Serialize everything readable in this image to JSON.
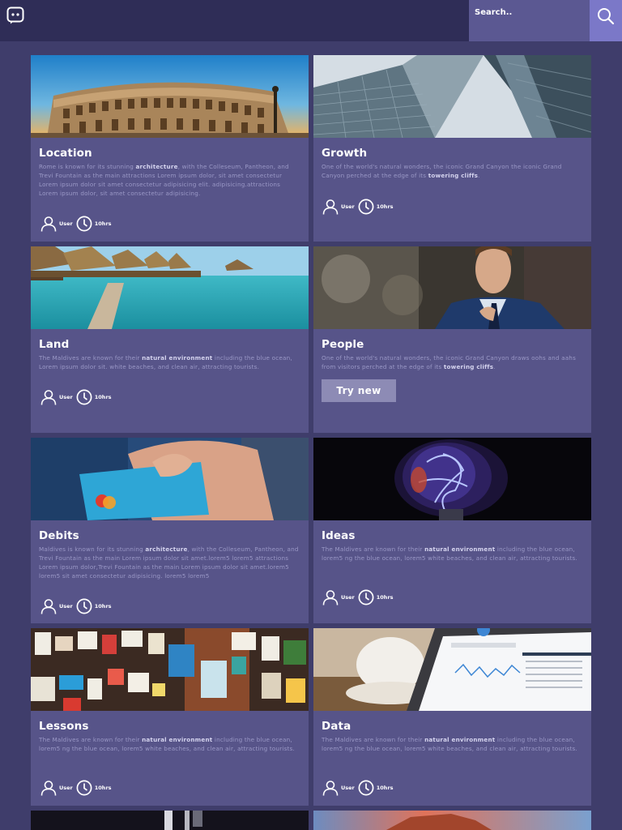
{
  "header": {
    "search_placeholder": "Search.."
  },
  "cards": [
    {
      "title": "Location",
      "desc_parts": [
        "Rome is known for its stunning ",
        "architecture",
        ", with the Colleseum, Pantheon, and Trevi Fountain as the main attractions Lorem ipsum dolor, sit amet consectetur Lorem ipsum dolor sit amet consectetur adipisicing elit. adipisicing.attractions Lorem ipsum dolor, sit amet consectetur adipisicing."
      ],
      "user_label": "User",
      "time_label": "10hrs"
    },
    {
      "title": "Growth",
      "desc_parts": [
        "One of the world's natural wonders, the iconic Grand Canyon the iconic Grand Canyon perched at the edge of its ",
        "towering cliffs",
        "."
      ],
      "user_label": "User",
      "time_label": "10hrs"
    },
    {
      "title": "Land",
      "desc_parts": [
        "The Maldives are known for their ",
        "natural environment",
        " including the blue ocean, Lorem ipsum dolor sit. white beaches, and clean air, attracting tourists."
      ],
      "user_label": "User",
      "time_label": "10hrs"
    },
    {
      "title": "People",
      "desc_parts": [
        "One of the world's natural wonders, the iconic Grand Canyon draws oohs and aahs from visitors perched at the edge of its ",
        "towering cliffs",
        "."
      ],
      "button_label": "Try new"
    },
    {
      "title": "Debits",
      "desc_parts": [
        "Maldives is known for its stunning ",
        "architecture",
        ", with the Colleseum, Pantheon, and Trevi Fountain as the main Lorem ipsum dolor sit amet.lorem5 lorem5 attractions Lorem ipsum dolor,Trevi Fountain as the main Lorem ipsum dolor sit amet.lorem5 lorem5 sit amet consectetur adipisicing. lorem5 lorem5"
      ],
      "user_label": "User",
      "time_label": "10hrs"
    },
    {
      "title": "Ideas",
      "desc_parts": [
        "The Maldives are known for their ",
        "natural environment",
        " including the blue ocean, lorem5 ng the blue ocean, lorem5 white beaches, and clean air, attracting tourists."
      ],
      "user_label": "User",
      "time_label": "10hrs"
    },
    {
      "title": "Lessons",
      "desc_parts": [
        "The Maldives are known for their ",
        "natural environment",
        " including the blue ocean, lorem5 ng the blue ocean, lorem5 white beaches, and clean air, attracting tourists."
      ],
      "user_label": "User",
      "time_label": "10hrs"
    },
    {
      "title": "Data",
      "desc_parts": [
        "The Maldives are known for their ",
        "natural environment",
        " including the blue ocean, lorem5 ng the blue ocean, lorem5 white beaches, and clean air, attracting tourists."
      ],
      "user_label": "User",
      "time_label": "10hrs"
    }
  ],
  "colors": {
    "background": "#3f3d6b",
    "topbar": "#2f2d57",
    "card": "#575489",
    "search_field": "#5b5892",
    "search_button": "#7b78c8",
    "try_button": "#8d8bb5"
  }
}
